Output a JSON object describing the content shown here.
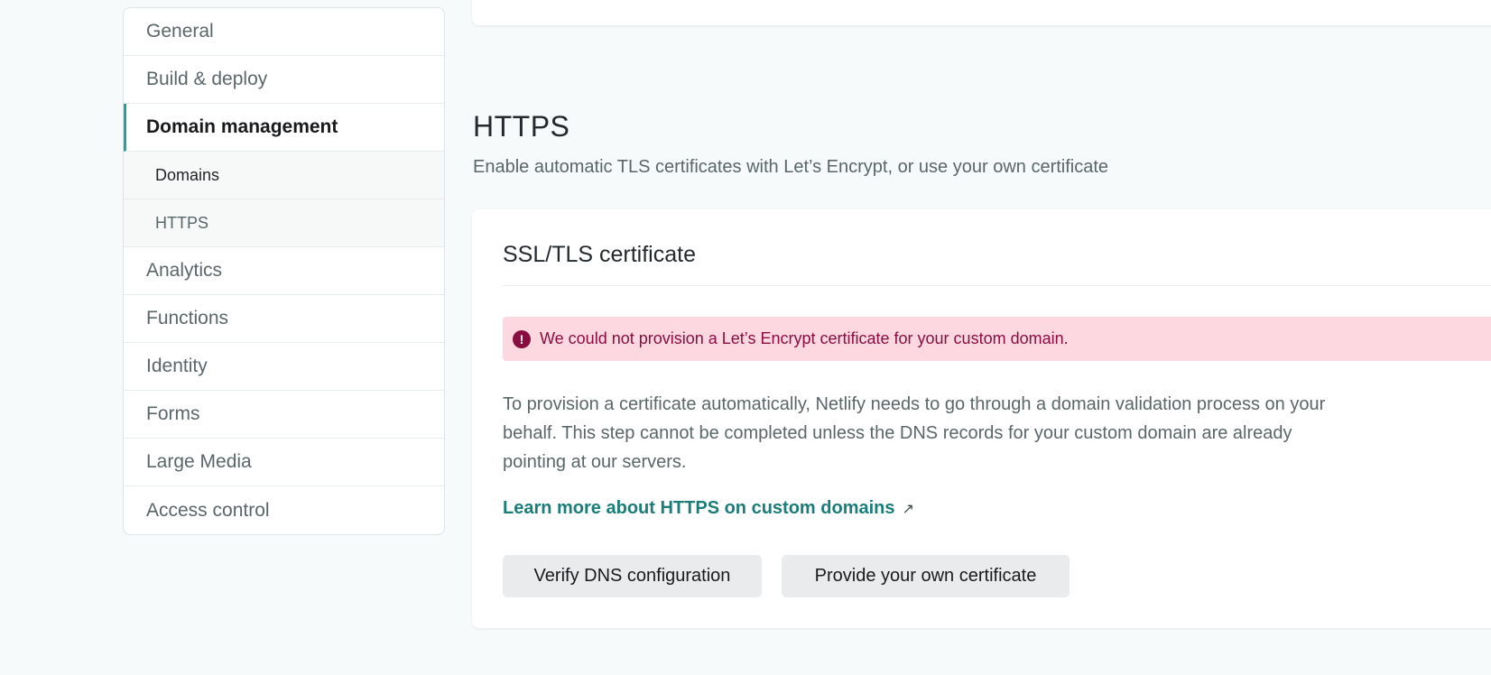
{
  "sidebar": {
    "items": [
      {
        "label": "General"
      },
      {
        "label": "Build & deploy"
      },
      {
        "label": "Domain management"
      },
      {
        "label": "Domains"
      },
      {
        "label": "HTTPS"
      },
      {
        "label": "Analytics"
      },
      {
        "label": "Functions"
      },
      {
        "label": "Identity"
      },
      {
        "label": "Forms"
      },
      {
        "label": "Large Media"
      },
      {
        "label": "Access control"
      }
    ]
  },
  "section": {
    "title": "HTTPS",
    "description": "Enable automatic TLS certificates with Let’s Encrypt, or use your own certificate"
  },
  "card": {
    "title": "SSL/TLS certificate",
    "alert_icon": "!",
    "alert_text": "We could not provision a Let’s Encrypt certificate for your custom domain.",
    "body": "To provision a certificate automatically, Netlify needs to go through a domain validation process on your behalf. This step cannot be completed unless the DNS records for your custom domain are already pointing at our servers.",
    "link_text": "Learn more about HTTPS on custom domains",
    "link_icon": "↗",
    "verify_button": "Verify DNS configuration",
    "provide_button": "Provide your own certificate"
  },
  "colors": {
    "accent": "#24a29b",
    "link": "#1a7d77",
    "alert_bg": "#fdd8e1",
    "alert_text": "#8a0d3f",
    "page_bg": "#f6fafa"
  },
  "icons": {
    "alert": "exclamation-circle-icon",
    "link": "external-link-icon"
  }
}
